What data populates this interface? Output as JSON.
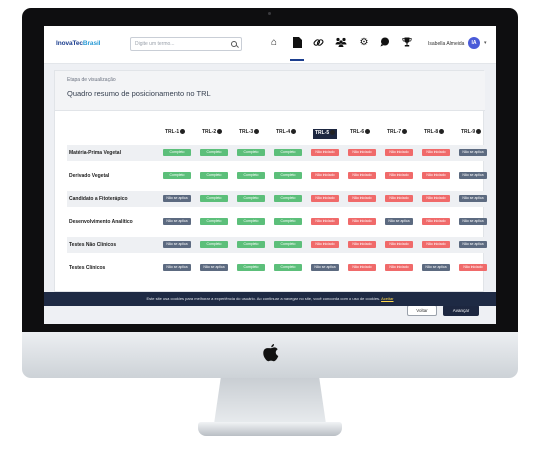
{
  "header": {
    "logo_main": "InovaTec",
    "logo_accent": "Brasil",
    "search_placeholder": "Digite um termo...",
    "nav_icons": [
      "home-icon",
      "document-icon",
      "link-icon",
      "users-icon",
      "gear-icon",
      "chat-icon",
      "trophy-icon"
    ],
    "user_name": "Isabella Almeida",
    "avatar_initials": "IA"
  },
  "card": {
    "subtitle": "Etapa de visualização",
    "title": "Quadro resumo de posicionamento no TRL"
  },
  "trl_levels": [
    "TRL-1",
    "TRL-2",
    "TRL-3",
    "TRL-4",
    "TRL-5",
    "TRL-6",
    "TRL-7",
    "TRL-8",
    "TRL-9"
  ],
  "selected_level": "TRL-5",
  "status_labels": {
    "C": "Completo",
    "N": "Não iniciado",
    "A": "Não se aplica"
  },
  "rows": [
    {
      "label": "Matéria-Prima Vegetal",
      "statuses": [
        "C",
        "C",
        "C",
        "C",
        "N",
        "N",
        "N",
        "N",
        "A"
      ]
    },
    {
      "label": "Derivado Vegetal",
      "statuses": [
        "C",
        "C",
        "C",
        "C",
        "N",
        "N",
        "N",
        "N",
        "A"
      ]
    },
    {
      "label": "Candidato a Fitoterápico",
      "statuses": [
        "A",
        "C",
        "C",
        "C",
        "N",
        "N",
        "N",
        "N",
        "A"
      ]
    },
    {
      "label": "Desenvolvimento Analítico",
      "statuses": [
        "A",
        "C",
        "C",
        "C",
        "N",
        "N",
        "A",
        "N",
        "A"
      ]
    },
    {
      "label": "Testes Não Clínicos",
      "statuses": [
        "A",
        "C",
        "C",
        "C",
        "N",
        "N",
        "N",
        "N",
        "A"
      ]
    },
    {
      "label": "Testes Clínicos",
      "statuses": [
        "A",
        "A",
        "C",
        "C",
        "A",
        "N",
        "N",
        "A",
        "N"
      ]
    }
  ],
  "buttons": {
    "back": "Voltar",
    "next": "Avançar"
  },
  "cookie_banner": {
    "text": "Este site usa cookies para melhorar a experiência do usuário. Ao continuar a navegar no site, você concorda com o uso de cookies.",
    "link": "Aceitar"
  },
  "colors": {
    "completo": "#5cbf7a",
    "nao_iniciado": "#f06a6a",
    "nao_se_aplica": "#5c6a80",
    "primary": "#1d2740"
  }
}
